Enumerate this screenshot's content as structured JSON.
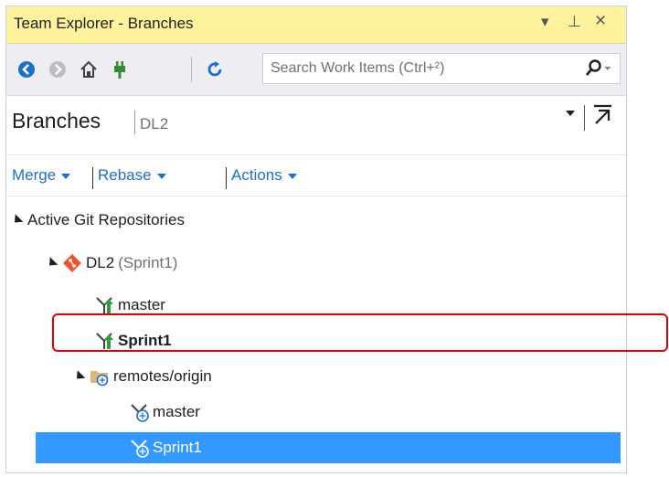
{
  "window": {
    "title": "Team Explorer - Branches",
    "controls": {
      "dropdown": "▾",
      "pin": "⊥",
      "close": "×"
    }
  },
  "toolbar": {
    "search_placeholder": "Search Work Items (Ctrl+²)"
  },
  "header": {
    "title": "Branches",
    "repo": "DL2"
  },
  "actions": [
    {
      "label": "Merge"
    },
    {
      "label": "Rebase"
    },
    {
      "label": "Actions"
    }
  ],
  "tree": {
    "group_label": "Active Git Repositories",
    "repo": {
      "name": "DL2",
      "current_branch": "(Sprint1)"
    },
    "local_branches": [
      {
        "name": "master"
      },
      {
        "name": "Sprint1"
      }
    ],
    "remote": {
      "name": "remotes/origin"
    },
    "remote_branches": [
      {
        "name": "master"
      },
      {
        "name": "Sprint1"
      }
    ]
  },
  "colors": {
    "title_bar": "#fff29d",
    "link": "#1e6fc9",
    "selection": "#3399ff",
    "callout": "#e00000",
    "git_icon": "#f05133",
    "branch_icon_green": "#2e9d3b"
  }
}
